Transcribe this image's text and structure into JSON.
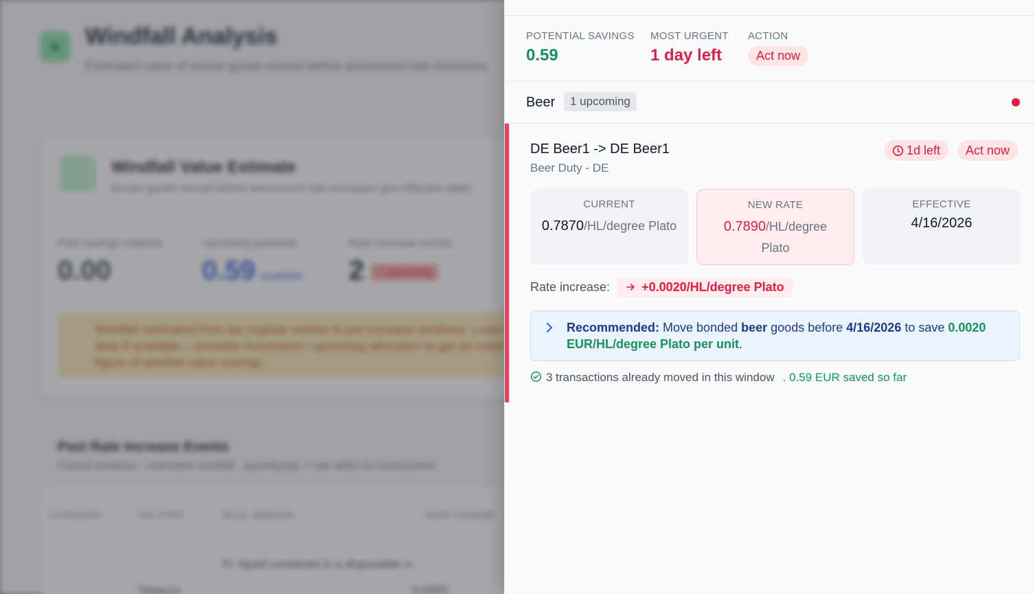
{
  "background": {
    "title": "Windfall Analysis",
    "subtitle": "Estimated value of excise goods moved before announced rate increases",
    "card": {
      "title": "Windfall Value Estimate",
      "subtitle": "Excise goods moved before announced rate increases (pre-effective date)",
      "stats": [
        {
          "label": "Past savings realized",
          "value": "0.00",
          "unit": ""
        },
        {
          "label": "Upcoming potential",
          "value": "0.59",
          "unit": "available"
        },
        {
          "label": "Rate increase events",
          "value": "2",
          "unit": "",
          "pill": "1 upcoming"
        }
      ],
      "note": "Windfall estimated from tax register entries in pre-increase windows. Load more data if available – simulate movement / upcoming allocation to get an exact figure of windfall value savings."
    },
    "section": {
      "title": "Past Rate Increase Events",
      "subtitle": "Closed windows · estimated windfall · quantity/qty × rate delta for transactions"
    },
    "table": {
      "headers": [
        "CATEGORY",
        "TAX TYPE",
        "RULE VERSION",
        "RATE CHANGE"
      ],
      "row_fragments": [
        "Tobacco",
        "Fl. liquid contained in a disposable e-",
        "0.0000"
      ]
    }
  },
  "summary": {
    "savings_label": "POTENTIAL SAVINGS",
    "savings_value": "0.59",
    "urgent_label": "MOST URGENT",
    "urgent_value": "1 day left",
    "action_label": "ACTION",
    "action_value": "Act now"
  },
  "group": {
    "name": "Beer",
    "badge": "1 upcoming"
  },
  "event": {
    "title": "DE Beer1 -> DE Beer1",
    "subtitle": "Beer Duty - DE",
    "time_badge": "1d left",
    "act_badge": "Act now",
    "current_label": "CURRENT",
    "current_value": "0.7870",
    "current_unit": "/HL/degree Plato",
    "new_label": "NEW RATE",
    "new_value": "0.7890",
    "new_unit": "/HL/degree Plato",
    "effective_label": "EFFECTIVE",
    "effective_value": "4/16/2026",
    "increase_label": "Rate increase:",
    "increase_value": "+0.0020/HL/degree Plato",
    "reco": {
      "lead": "Recommended:",
      "t1": " Move bonded ",
      "goods": "beer",
      "t2": " goods before ",
      "date": "4/16/2026",
      "t3": " to save ",
      "amount": "0.0020 EUR/HL/degree Plato per unit",
      "t4": "."
    },
    "moved_text": "3 transactions already moved in this window",
    "saved_text": ". 0.59 EUR saved so far"
  },
  "colors": {
    "accent_red": "#e11d48",
    "accent_green": "#15935b",
    "accent_blue": "#1e3a8a"
  }
}
